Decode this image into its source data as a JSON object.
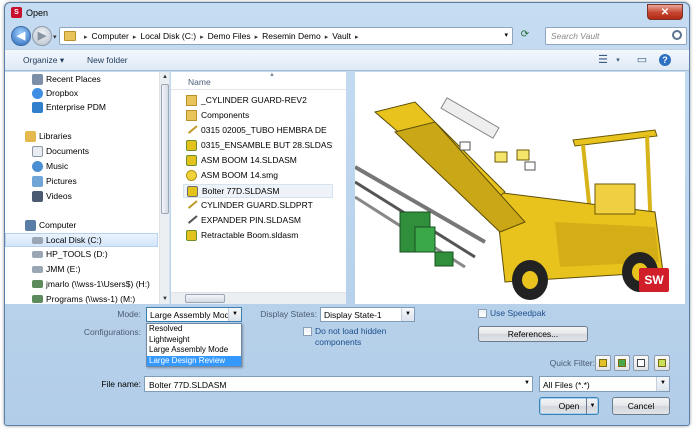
{
  "window": {
    "title": "Open",
    "close_glyph": "✕"
  },
  "nav": {
    "back_glyph": "◀",
    "forward_glyph": "▶",
    "breadcrumbs": [
      "Computer",
      "Local Disk (C:)",
      "Demo Files",
      "Resemin Demo",
      "Vault"
    ],
    "search_placeholder": "Search Vault"
  },
  "toolbar": {
    "organize_label": "Organize ▾",
    "new_folder_label": "New folder"
  },
  "sidebar": {
    "favorites": [
      {
        "label": "Recent Places",
        "icon": "recent-places-icon"
      },
      {
        "label": "Dropbox",
        "icon": "dropbox-icon"
      },
      {
        "label": "Enterprise PDM",
        "icon": "enterprise-pdm-icon"
      }
    ],
    "libraries_label": "Libraries",
    "libraries": [
      {
        "label": "Documents",
        "icon": "documents-icon"
      },
      {
        "label": "Music",
        "icon": "music-icon"
      },
      {
        "label": "Pictures",
        "icon": "pictures-icon"
      },
      {
        "label": "Videos",
        "icon": "videos-icon"
      }
    ],
    "computer_label": "Computer",
    "drives": [
      {
        "label": "Local Disk (C:)",
        "icon": "local-disk-icon",
        "selected": true
      },
      {
        "label": "HP_TOOLS (D:)",
        "icon": "drive-icon"
      },
      {
        "label": "JMM (E:)",
        "icon": "drive-icon"
      },
      {
        "label": "jmarlo (\\\\wss-1\\Users$) (H:)",
        "icon": "network-drive-icon"
      },
      {
        "label": "Programs (\\\\wss-1) (M:)",
        "icon": "network-drive-icon"
      }
    ]
  },
  "file_list": {
    "column_header": "Name",
    "files": [
      {
        "name": "_CYLINDER GUARD-REV2",
        "icon": "folder-icon"
      },
      {
        "name": "Components",
        "icon": "folder-icon"
      },
      {
        "name": "0315 02005_TUBO HEMBRA DE",
        "icon": "part-icon"
      },
      {
        "name": "0315_ENSAMBLE BUT 28.SLDASM",
        "icon": "assembly-icon"
      },
      {
        "name": "ASM BOOM 14.SLDASM",
        "icon": "assembly-icon"
      },
      {
        "name": "ASM BOOM 14.smg",
        "icon": "composer-icon"
      },
      {
        "name": "Bolter 77D.SLDASM",
        "icon": "assembly-icon",
        "selected": true
      },
      {
        "name": "CYLINDER GUARD.SLDPRT",
        "icon": "part-icon"
      },
      {
        "name": "EXPANDER PIN.SLDASM",
        "icon": "part-icon"
      },
      {
        "name": "Retractable Boom.sldasm",
        "icon": "assembly-icon"
      }
    ]
  },
  "preview": {
    "badge": "SW"
  },
  "options": {
    "mode_label": "Mode:",
    "mode_value": "Large Assembly Mod",
    "mode_options": [
      "Resolved",
      "Lightweight",
      "Large Assembly Mode",
      "Large Design Review"
    ],
    "mode_highlighted": "Large Design Review",
    "configurations_label": "Configurations:",
    "display_states_label": "Display States:",
    "display_states_value": "Display State-1",
    "no_load_hidden_line1": "Do not load hidden",
    "no_load_hidden_line2": "components",
    "use_speedpak_label": "Use Speedpak",
    "references_label": "References...",
    "quick_filter_label": "Quick Filter:"
  },
  "footer": {
    "file_name_label": "File name:",
    "file_name_value": "Bolter 77D.SLDASM",
    "file_type_value": "All Files (*.*)",
    "open_label": "Open",
    "cancel_label": "Cancel"
  },
  "colors": {
    "accent_blue": "#3399ff",
    "title_close_red": "#c6452f",
    "sw_red": "#d11f2a",
    "machine_yellow": "#e8c31e"
  }
}
